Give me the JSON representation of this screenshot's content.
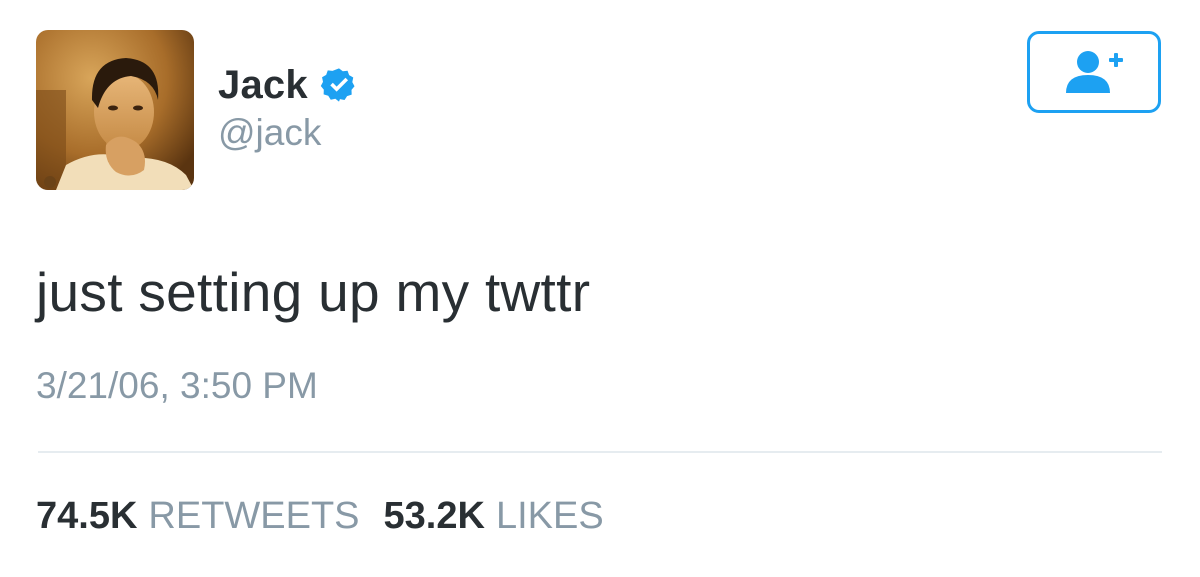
{
  "user": {
    "display_name": "Jack",
    "handle": "@jack",
    "verified": true,
    "avatar_icon": "profile-photo",
    "verified_icon": "verified-badge-icon"
  },
  "actions": {
    "follow_icon": "add-user-icon"
  },
  "tweet": {
    "text": "just setting up my twttr",
    "timestamp": "3/21/06, 3:50 PM"
  },
  "stats": [
    {
      "count": "74.5K",
      "label": "RETWEETS"
    },
    {
      "count": "53.2K",
      "label": "LIKES"
    }
  ],
  "colors": {
    "accent": "#1da1f2",
    "text_primary": "#292f33",
    "text_secondary": "#8899a6",
    "divider": "#e6ecf0"
  }
}
